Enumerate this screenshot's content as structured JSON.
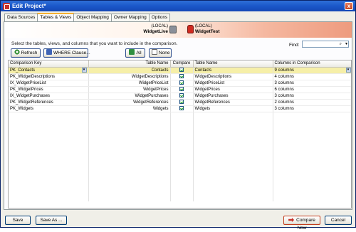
{
  "window": {
    "title": "Edit Project*",
    "close_label": "x"
  },
  "tabs": [
    {
      "label": "Data Sources",
      "active": false
    },
    {
      "label": "Tables & Views",
      "active": true
    },
    {
      "label": "Object Mapping",
      "active": false
    },
    {
      "label": "Owner Mapping",
      "active": false
    },
    {
      "label": "Options",
      "active": false
    }
  ],
  "banner": {
    "source": {
      "server": "(LOCAL)",
      "database": "WidgetLive"
    },
    "target": {
      "server": "(LOCAL)",
      "database": "WidgetTest"
    }
  },
  "toolbar": {
    "instructions": "Select the tables, views, and columns that you want to include in the comparison.",
    "refresh_label": "Refresh",
    "where_label": "WHERE Clause...",
    "all_label": "All",
    "none_label": "None",
    "find_label": "Find:",
    "find_value": ""
  },
  "grid": {
    "columns": [
      "Comparison Key",
      "Table Name",
      "Compare",
      "Table Name",
      "Columns in Comparison"
    ],
    "rows": [
      {
        "key": "PK_Contacts",
        "left": "Contacts",
        "compare": true,
        "right": "Contacts",
        "columns": "9 columns",
        "selected": true
      },
      {
        "key": "PK_WidgetDescriptions",
        "left": "WidgetDescriptions",
        "compare": true,
        "right": "WidgetDescriptions",
        "columns": "4 columns",
        "selected": false
      },
      {
        "key": "IX_WidgetPriceList",
        "left": "WidgetPriceList",
        "compare": true,
        "right": "WidgetPriceList",
        "columns": "3 columns",
        "selected": false
      },
      {
        "key": "PK_WidgetPrices",
        "left": "WidgetPrices",
        "compare": true,
        "right": "WidgetPrices",
        "columns": "6 columns",
        "selected": false
      },
      {
        "key": "IX_WidgetPurchases",
        "left": "WidgetPurchases",
        "compare": true,
        "right": "WidgetPurchases",
        "columns": "3 columns",
        "selected": false
      },
      {
        "key": "PK_WidgetReferences",
        "left": "WidgetReferences",
        "compare": true,
        "right": "WidgetReferences",
        "columns": "2 columns",
        "selected": false
      },
      {
        "key": "PK_Widgets",
        "left": "Widgets",
        "compare": true,
        "right": "Widgets",
        "columns": "3 columns",
        "selected": false
      }
    ]
  },
  "footer": {
    "save_label": "Save",
    "save_as_label": "Save As ...",
    "compare_label": "Compare Now",
    "cancel_label": "Cancel"
  },
  "colors": {
    "titlebar": "#1b57c9",
    "selected_row": "#f6efa8",
    "tab_accent": "#f5b031",
    "target_db": "#d02a20"
  }
}
